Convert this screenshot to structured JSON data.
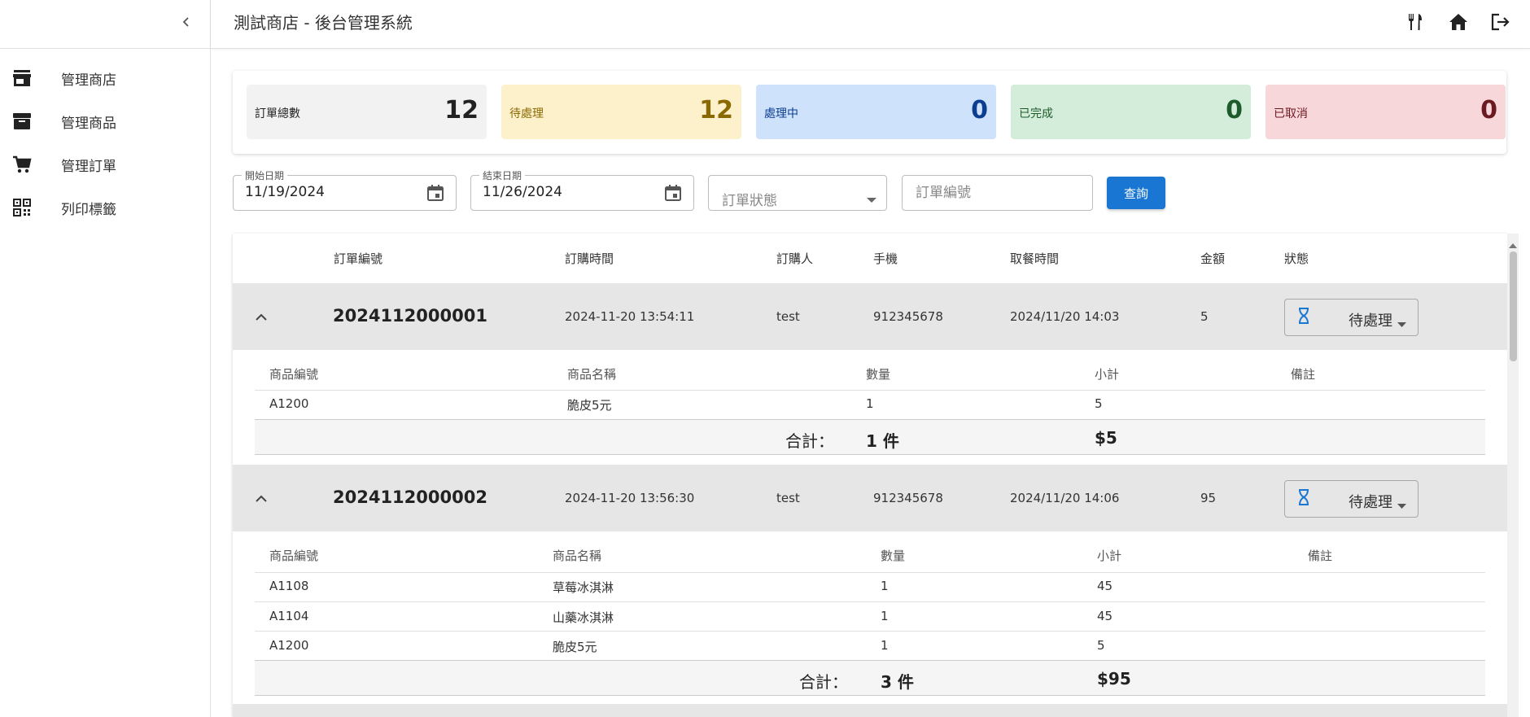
{
  "app": {
    "title": "測試商店 - 後台管理系統"
  },
  "icons": {
    "collapse": "chevron-left-icon",
    "top": [
      "utensils-icon",
      "home-icon",
      "logout-icon"
    ]
  },
  "sidebar": {
    "items": [
      {
        "label": "管理商店",
        "icon": "store-icon"
      },
      {
        "label": "管理商品",
        "icon": "archive-icon"
      },
      {
        "label": "管理訂單",
        "icon": "cart-icon"
      },
      {
        "label": "列印標籤",
        "icon": "qr-code-icon"
      }
    ]
  },
  "summary": {
    "total": {
      "label": "訂單總數",
      "value": "12",
      "bg": "#f2f2f2",
      "fg": "#222222"
    },
    "pending": {
      "label": "待處理",
      "value": "12",
      "bg": "#fdf1cc",
      "fg": "#8a6a00"
    },
    "processing": {
      "label": "處理中",
      "value": "0",
      "bg": "#cfe2fb",
      "fg": "#0b3d91"
    },
    "completed": {
      "label": "已完成",
      "value": "0",
      "bg": "#d4eddb",
      "fg": "#1e5b2a"
    },
    "cancelled": {
      "label": "已取消",
      "value": "0",
      "bg": "#f8d7da",
      "fg": "#6b1a21"
    }
  },
  "filters": {
    "start_label": "開始日期",
    "start_value": "11/19/2024",
    "end_label": "結束日期",
    "end_value": "11/26/2024",
    "status_placeholder": "訂單狀態",
    "order_placeholder": "訂單編號",
    "query_label": "查詢"
  },
  "table": {
    "headers": {
      "order_no": "訂單編號",
      "order_time": "訂購時間",
      "buyer": "訂購人",
      "phone": "手機",
      "pickup": "取餐時間",
      "amount": "金額",
      "status": "狀態"
    },
    "detail_headers": {
      "code": "商品編號",
      "name": "商品名稱",
      "qty": "數量",
      "subtotal": "小計",
      "note": "備註"
    },
    "total_label": "合計：",
    "orders": [
      {
        "order_no": "2024112000001",
        "order_time": "2024-11-20 13:54:11",
        "buyer": "test",
        "phone": "912345678",
        "pickup": "2024/11/20 14:03",
        "amount": "5",
        "status": "待處理",
        "items": [
          {
            "code": "A1200",
            "name": "脆皮5元",
            "qty": "1",
            "subtotal": "5"
          }
        ],
        "total_qty": "1 件",
        "total_amount": "$5"
      },
      {
        "order_no": "2024112000002",
        "order_time": "2024-11-20 13:56:30",
        "buyer": "test",
        "phone": "912345678",
        "pickup": "2024/11/20 14:06",
        "amount": "95",
        "status": "待處理",
        "items": [
          {
            "code": "A1108",
            "name": "草莓冰淇淋",
            "qty": "1",
            "subtotal": "45"
          },
          {
            "code": "A1104",
            "name": "山藥冰淇淋",
            "qty": "1",
            "subtotal": "45"
          },
          {
            "code": "A1200",
            "name": "脆皮5元",
            "qty": "1",
            "subtotal": "5"
          }
        ],
        "total_qty": "3 件",
        "total_amount": "$95"
      }
    ]
  }
}
